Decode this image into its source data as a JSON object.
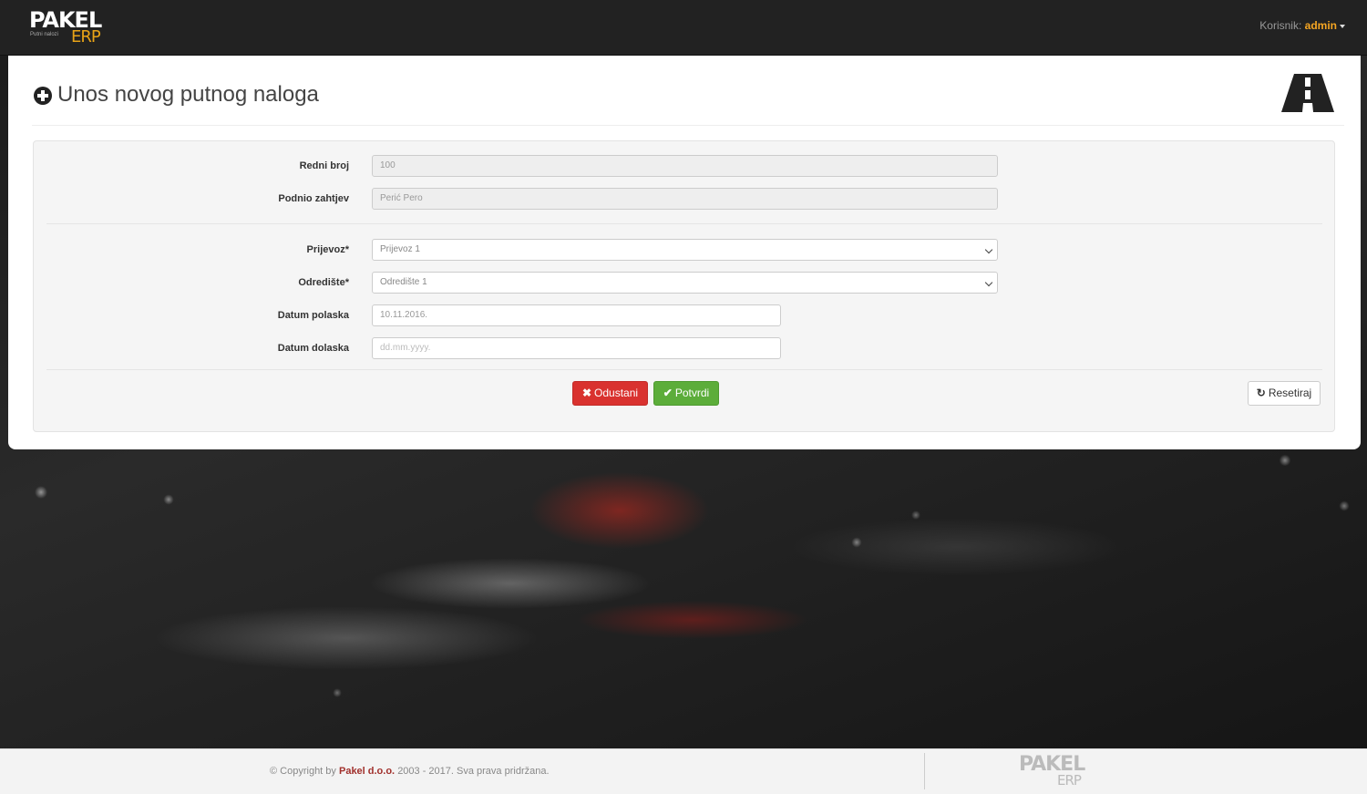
{
  "navbar": {
    "logo_main": "PAKEL",
    "logo_sub": "Putni nalozi",
    "logo_erp": "ERP",
    "user_label": "Korisnik:",
    "user_name": "admin"
  },
  "header": {
    "title": "Unos novog putnog naloga",
    "icon": "plus-circle-icon",
    "brand_icon": "road-icon"
  },
  "form": {
    "redni_broj": {
      "label": "Redni broj",
      "value": "100"
    },
    "podnio_zahtjev": {
      "label": "Podnio zahtjev",
      "value": "Perić Pero"
    },
    "prijevoz": {
      "label": "Prijevoz*",
      "value": "Prijevoz 1"
    },
    "odrediste": {
      "label": "Odredište*",
      "value": "Odredište 1"
    },
    "datum_polaska": {
      "label": "Datum polaska",
      "value": "10.11.2016."
    },
    "datum_dolaska": {
      "label": "Datum dolaska",
      "placeholder": "dd.mm.yyyy."
    }
  },
  "buttons": {
    "cancel": "Odustani",
    "confirm": "Potvrdi",
    "reset": "Resetiraj"
  },
  "footer": {
    "copyright_prefix": "© Copyright by",
    "company": "Pakel d.o.o.",
    "copyright_suffix": "2003 - 2017. Sva prava pridržana.",
    "logo_main": "PAKEL",
    "logo_erp": "ERP"
  },
  "colors": {
    "navbar": "#222222",
    "accent": "#f5a623",
    "danger": "#d9322f",
    "success": "#5cad3a"
  }
}
